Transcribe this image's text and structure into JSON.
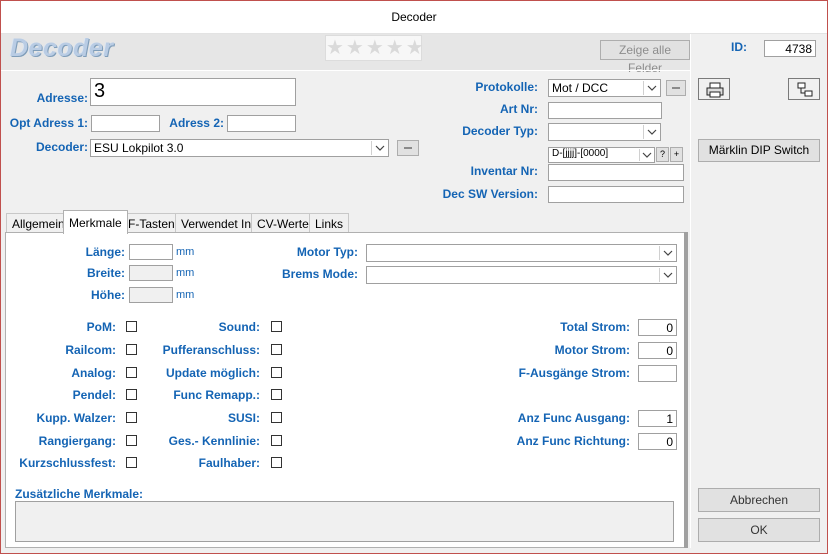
{
  "window": {
    "title": "Decoder"
  },
  "header": {
    "logo": "Decoder",
    "stars": "★★★★★",
    "show_all_fields_label": "Zeige alle Felder",
    "id_label": "ID:",
    "id_value": "4738"
  },
  "general": {
    "adresse_label": "Adresse:",
    "adresse_value": "3",
    "opt_adress1_label": "Opt Adress 1:",
    "opt_adress1_value": "",
    "adress2_label": "Adress 2:",
    "adress2_value": "",
    "decoder_label": "Decoder:",
    "decoder_value": "ESU Lokpilot 3.0",
    "protokolle_label": "Protokolle:",
    "protokolle_value": "Mot / DCC",
    "artnr_label": "Art Nr:",
    "artnr_value": "",
    "decoder_typ_label": "Decoder Typ:",
    "decoder_typ_value": "",
    "inventar_format_value": "D-[jjjj]-[0000]",
    "inventar_label": "Inventar Nr:",
    "inventar_value": "",
    "dec_sw_label": "Dec SW Version:",
    "dec_sw_value": "",
    "help_button": "?",
    "add_button": "+"
  },
  "right_panel": {
    "maerklin_button": "Märklin DIP Switch",
    "cancel_button": "Abbrechen",
    "ok_button": "OK"
  },
  "tabs": [
    {
      "label": "Allgemein",
      "active": false
    },
    {
      "label": "Merkmale",
      "active": true
    },
    {
      "label": "F-Tasten",
      "active": false
    },
    {
      "label": "Verwendet In",
      "active": false
    },
    {
      "label": "CV-Werte",
      "active": false
    },
    {
      "label": "Links",
      "active": false
    }
  ],
  "merkmale": {
    "laenge_label": "Länge:",
    "breite_label": "Breite:",
    "hoehe_label": "Höhe:",
    "unit_mm": "mm",
    "laenge_value": "",
    "breite_value": "",
    "hoehe_value": "",
    "motor_typ_label": "Motor Typ:",
    "motor_typ_value": "",
    "brems_mode_label": "Brems Mode:",
    "brems_mode_value": "",
    "col1": [
      {
        "label": "PoM:",
        "checked": false
      },
      {
        "label": "Railcom:",
        "checked": false
      },
      {
        "label": "Analog:",
        "checked": false
      },
      {
        "label": "Pendel:",
        "checked": false
      },
      {
        "label": "Kupp. Walzer:",
        "checked": false
      },
      {
        "label": "Rangiergang:",
        "checked": false
      },
      {
        "label": "Kurzschlussfest:",
        "checked": false
      }
    ],
    "col2": [
      {
        "label": "Sound:",
        "checked": false
      },
      {
        "label": "Pufferanschluss:",
        "checked": false
      },
      {
        "label": "Update möglich:",
        "checked": false
      },
      {
        "label": "Func Remapp.:",
        "checked": false
      },
      {
        "label": "SUSI:",
        "checked": false
      },
      {
        "label": "Ges.- Kennlinie:",
        "checked": false
      },
      {
        "label": "Faulhaber:",
        "checked": false
      }
    ],
    "total_strom_label": "Total Strom:",
    "total_strom_value": "0",
    "motor_strom_label": "Motor Strom:",
    "motor_strom_value": "0",
    "f_ausgaenge_strom_label": "F-Ausgänge Strom:",
    "f_ausgaenge_strom_value": "",
    "anz_func_ausgang_label": "Anz Func Ausgang:",
    "anz_func_ausgang_value": "1",
    "anz_func_richtung_label": "Anz Func Richtung:",
    "anz_func_richtung_value": "0",
    "zusaetzliche_label": "Zusätzliche Merkmale:",
    "zusaetzliche_value": ""
  }
}
